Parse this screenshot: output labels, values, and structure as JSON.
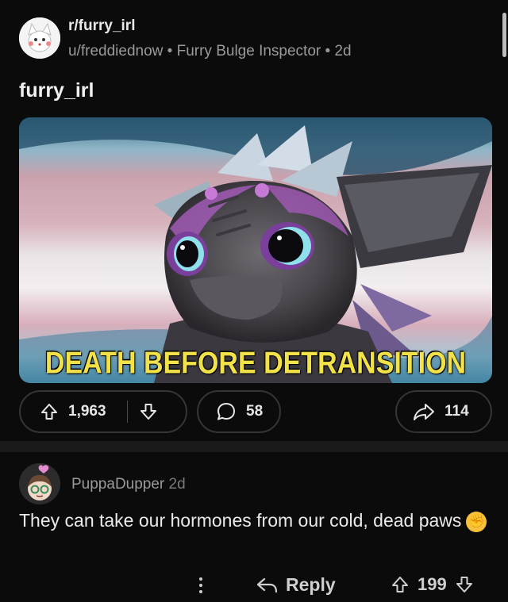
{
  "post": {
    "subreddit": "r/furry_irl",
    "author": "u/freddiednow",
    "flair": "Furry Bulge Inspector",
    "age": "2d",
    "meta_separator": "•",
    "title": "furry_irl",
    "image_caption": "DEATH BEFORE DETRANSITION",
    "upvotes": "1,963",
    "comments": "58",
    "shares": "114"
  },
  "comment": {
    "author": "PuppaDupper",
    "age": "2d",
    "body": "They can take our hormones from our cold, dead paws",
    "emoji": "✊",
    "reply_label": "Reply",
    "score": "199"
  },
  "icons": {
    "upvote": "arrow-up-icon",
    "downvote": "arrow-down-icon",
    "comment": "speech-bubble-icon",
    "share": "share-arrow-icon",
    "reply": "reply-arrow-icon",
    "more": "more-vertical-icon"
  },
  "colors": {
    "background": "#0b0b0b",
    "caption": "#f2e24a",
    "flag_blue": "#5bcefa",
    "flag_pink": "#f5a9b8",
    "flag_white": "#ffffff"
  }
}
